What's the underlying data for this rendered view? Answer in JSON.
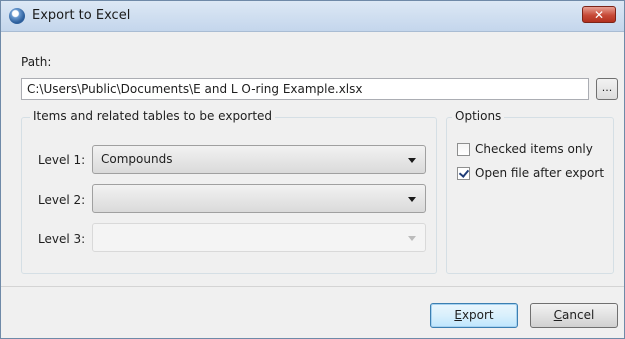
{
  "window": {
    "title": "Export to Excel",
    "close_symbol": "✕"
  },
  "path": {
    "label": "Path:",
    "value": "C:\\Users\\Public\\Documents\\E and L O-ring Example.xlsx",
    "browse_label": "..."
  },
  "items_group": {
    "title": "Items and related tables to be exported",
    "levels": [
      {
        "label": "Level 1:",
        "value": "Compounds",
        "enabled": true
      },
      {
        "label": "Level 2:",
        "value": "",
        "enabled": true
      },
      {
        "label": "Level 3:",
        "value": "",
        "enabled": false
      }
    ]
  },
  "options_group": {
    "title": "Options",
    "checked_items_only": {
      "label": "Checked items only",
      "checked": false
    },
    "open_file_after_export": {
      "label": "Open file after export",
      "checked": true
    }
  },
  "buttons": {
    "export": {
      "mnemonic": "E",
      "rest": "xport"
    },
    "cancel": {
      "mnemonic": "C",
      "rest": "ancel"
    }
  },
  "icons": {
    "app": "app-logo-icon",
    "close": "close-icon",
    "dropdown": "chevron-down-icon",
    "check": "checkmark-icon"
  },
  "colors": {
    "close_button": "#c74a38",
    "default_button_border": "#3c7fb1",
    "checkmark": "#1f3d78"
  }
}
